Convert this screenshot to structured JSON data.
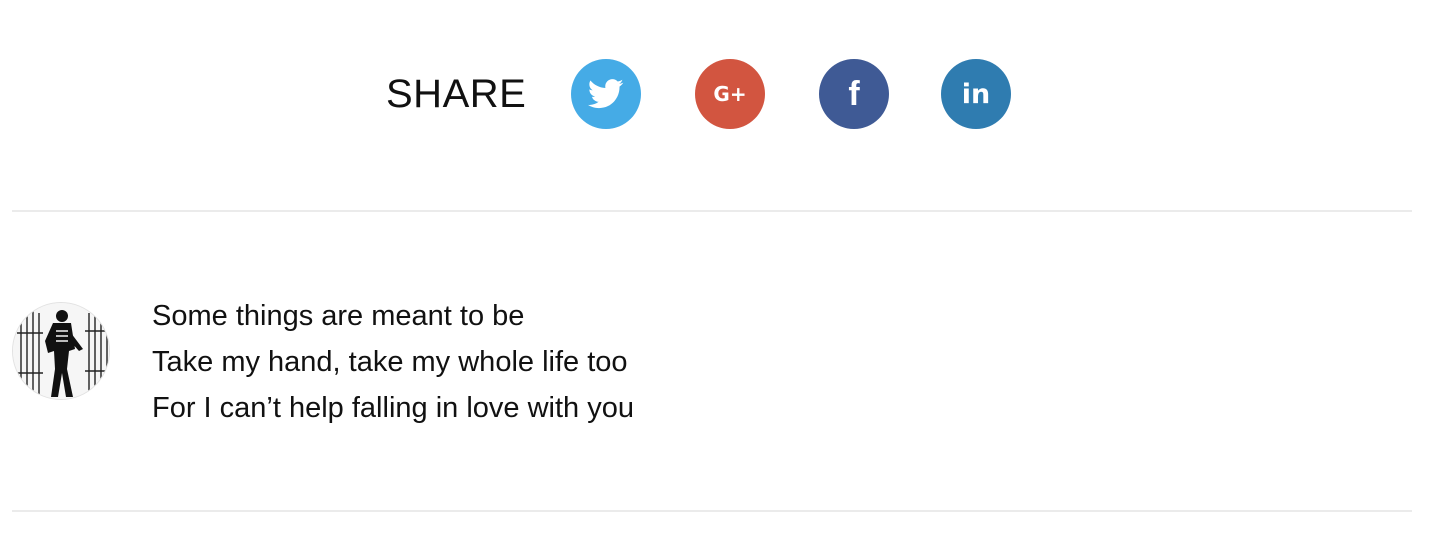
{
  "share": {
    "label": "SHARE",
    "buttons": [
      {
        "network": "twitter",
        "icon": "twitter-icon",
        "color": "#45ABE6"
      },
      {
        "network": "google-plus",
        "icon": "google-plus-icon",
        "color": "#D25540",
        "glyph": "G+"
      },
      {
        "network": "facebook",
        "icon": "facebook-icon",
        "color": "#3F5A95",
        "glyph": "f"
      },
      {
        "network": "linkedin",
        "icon": "linkedin-icon",
        "color": "#2F7CB0",
        "glyph": "in"
      }
    ]
  },
  "quote": {
    "avatar_icon": "person-avatar-icon",
    "lines": [
      "Some things are meant to be",
      "Take my hand, take my whole life too",
      "For I can’t help falling in love with you"
    ]
  },
  "colors": {
    "divider": "#EBEBEB",
    "text": "#111111"
  }
}
